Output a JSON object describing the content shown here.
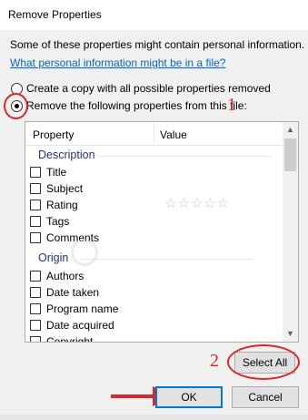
{
  "window": {
    "title": "Remove Properties"
  },
  "info_text": "Some of these properties might contain personal information.",
  "info_link": "What personal information might be in a file?",
  "options": {
    "copy_label": "Create a copy with all possible properties removed",
    "remove_label": "Remove the following properties from this file:"
  },
  "annotations": {
    "one": "1",
    "two": "2",
    "color": "#d42a2a"
  },
  "list": {
    "header_property": "Property",
    "header_value": "Value",
    "groups": [
      {
        "name": "Description",
        "items": [
          "Title",
          "Subject",
          "Rating",
          "Tags",
          "Comments"
        ]
      },
      {
        "name": "Origin",
        "items": [
          "Authors",
          "Date taken",
          "Program name",
          "Date acquired",
          "Copyright"
        ]
      }
    ],
    "rating_stars": "☆☆☆☆☆"
  },
  "buttons": {
    "select_all": "Select All",
    "ok": "OK",
    "cancel": "Cancel"
  },
  "colors": {
    "link": "#0066cc",
    "group_header": "#1e3287",
    "focus": "#0078d7"
  }
}
